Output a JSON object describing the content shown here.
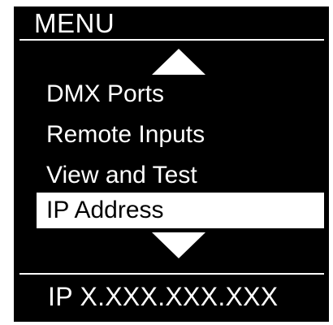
{
  "header": {
    "title": "MENU"
  },
  "navigation": {
    "up_icon": "triangle-up-icon",
    "down_icon": "triangle-down-icon"
  },
  "menu": {
    "items": [
      {
        "label": "DMX Ports",
        "selected": false
      },
      {
        "label": "Remote Inputs",
        "selected": false
      },
      {
        "label": "View and Test",
        "selected": false
      },
      {
        "label": "IP Address",
        "selected": true
      }
    ]
  },
  "status": {
    "text": "IP X.XXX.XXX.XXX"
  },
  "colors": {
    "background": "#000000",
    "foreground": "#ffffff",
    "selected_background": "#ffffff",
    "selected_foreground": "#000000"
  }
}
